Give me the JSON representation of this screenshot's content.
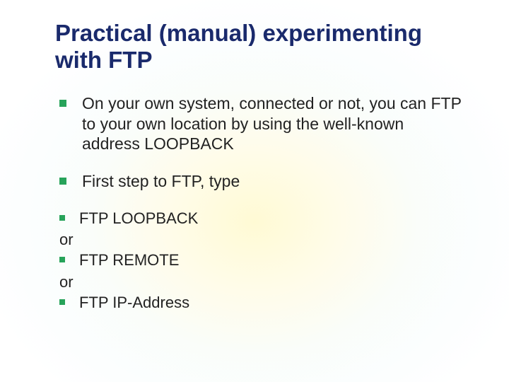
{
  "title": "Practical (manual) experimenting with FTP",
  "bullets": {
    "b1": "On your own system, connected or not, you can FTP to your own location by using the well-known address LOOPBACK",
    "b2": "First step to FTP, type"
  },
  "commands": {
    "c1": "FTP LOOPBACK",
    "or1": "or",
    "c2": "FTP REMOTE",
    "or2": "or",
    "c3": "FTP IP-Address"
  }
}
